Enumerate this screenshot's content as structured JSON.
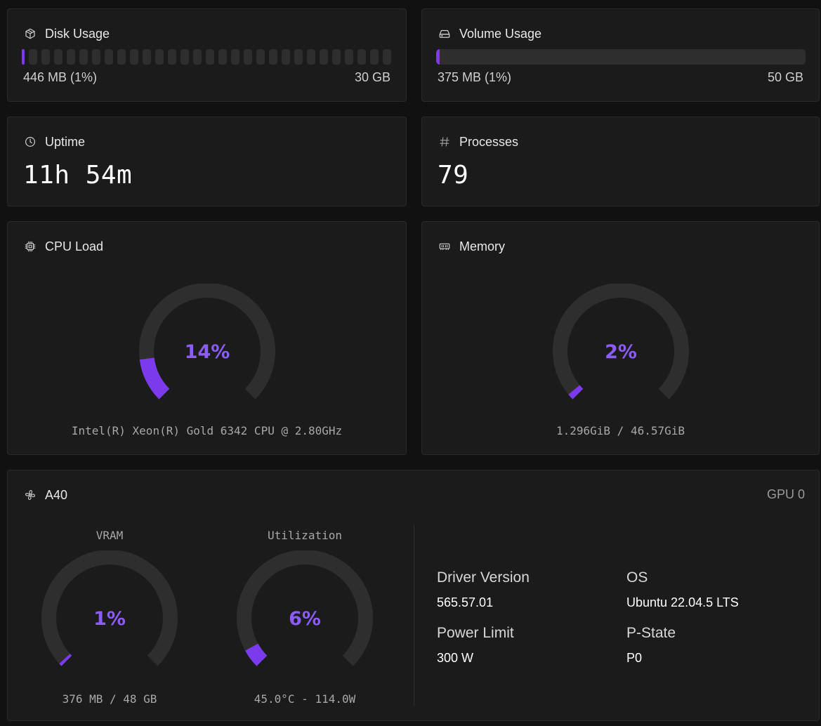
{
  "colors": {
    "accent": "#7c3aed",
    "gauge_text": "#8b5cf6",
    "track": "#2e2e2e",
    "card": "#1b1b1b",
    "background": "#111111"
  },
  "disk": {
    "title": "Disk Usage",
    "icon": "package-icon",
    "used": "446 MB (1%)",
    "total": "30 GB",
    "percent": 1,
    "segments": 30
  },
  "volume": {
    "title": "Volume Usage",
    "icon": "hard-drive-icon",
    "used": "375 MB (1%)",
    "total": "50 GB",
    "percent": 1
  },
  "uptime": {
    "title": "Uptime",
    "icon": "clock-icon",
    "value": "11h 54m"
  },
  "processes": {
    "title": "Processes",
    "icon": "hash-icon",
    "value": "79"
  },
  "cpu": {
    "title": "CPU Load",
    "icon": "cpu-icon",
    "percent": 14,
    "label": "14%",
    "caption": "Intel(R) Xeon(R) Gold 6342 CPU @ 2.80GHz"
  },
  "memory": {
    "title": "Memory",
    "icon": "memory-stick-icon",
    "percent": 2,
    "label": "2%",
    "caption": "1.296GiB / 46.57GiB"
  },
  "gpu": {
    "title": "A40",
    "icon": "fan-icon",
    "tag": "GPU 0",
    "vram": {
      "heading": "VRAM",
      "percent": 1,
      "label": "1%",
      "caption": "376 MB / 48 GB"
    },
    "utilization": {
      "heading": "Utilization",
      "percent": 6,
      "label": "6%",
      "caption": "45.0°C - 114.0W"
    },
    "info": {
      "driver_label": "Driver Version",
      "driver_value": "565.57.01",
      "os_label": "OS",
      "os_value": "Ubuntu 22.04.5 LTS",
      "power_label": "Power Limit",
      "power_value": "300 W",
      "pstate_label": "P-State",
      "pstate_value": "P0"
    }
  }
}
